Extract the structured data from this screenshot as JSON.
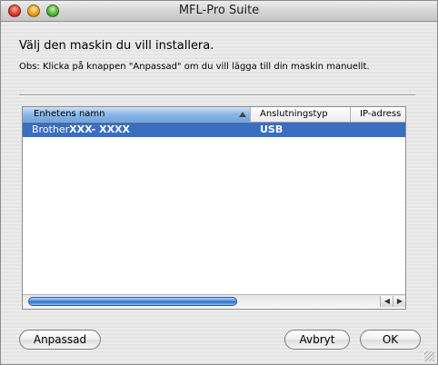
{
  "window": {
    "title": "MFL-Pro Suite"
  },
  "dialog": {
    "heading": "Välj den maskin du vill installera.",
    "note": "Obs: Klicka på knappen \"Anpassad\" om du vill lägga till din maskin manuellt."
  },
  "table": {
    "columns": [
      "Enhetens namn",
      "Anslutningstyp",
      "IP-adress"
    ],
    "sort_column": "Enhetens namn",
    "rows": [
      {
        "name_prefix": "Brother",
        "name_model": "XXX- XXXX",
        "connection": "USB",
        "ip": "",
        "selected": true
      }
    ],
    "selection_color": "#3a6ec0"
  },
  "buttons": {
    "custom": "Anpassad",
    "cancel": "Avbryt",
    "ok": "OK"
  },
  "icons": {
    "close": "close-traffic-light-icon",
    "minimize": "minimize-traffic-light-icon",
    "zoom": "zoom-traffic-light-icon",
    "sort": "sort-ascending-icon",
    "scroll_left": "scroll-left-arrow-icon",
    "scroll_right": "scroll-right-arrow-icon",
    "resize": "resize-grip-icon"
  }
}
